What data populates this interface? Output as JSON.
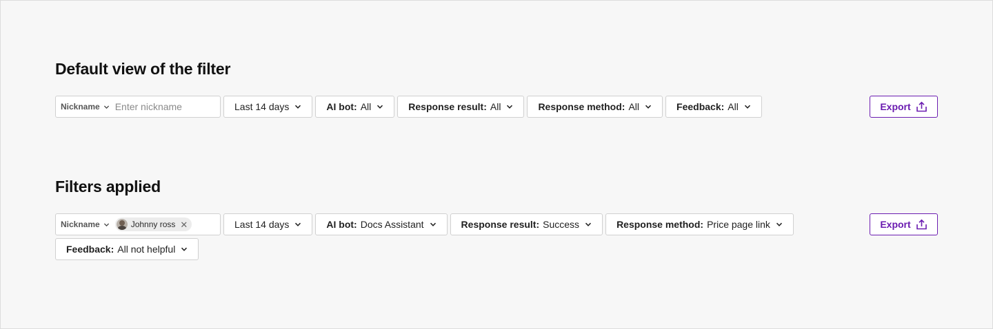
{
  "default_section": {
    "title": "Default view of the filter",
    "nickname": {
      "select_label": "Nickname",
      "placeholder": "Enter nickname"
    },
    "date_range": "Last 14 days",
    "ai_bot": {
      "label": "AI bot:",
      "value": "All"
    },
    "response_result": {
      "label": "Response result:",
      "value": "All"
    },
    "response_method": {
      "label": "Response method:",
      "value": "All"
    },
    "feedback": {
      "label": "Feedback:",
      "value": "All"
    },
    "export_label": "Export"
  },
  "applied_section": {
    "title": "Filters applied",
    "nickname": {
      "select_label": "Nickname",
      "tag": "Johnny ross"
    },
    "date_range": "Last 14 days",
    "ai_bot": {
      "label": "AI bot:",
      "value": "Docs Assistant"
    },
    "response_result": {
      "label": "Response result:",
      "value": "Success"
    },
    "response_method": {
      "label": "Response method:",
      "value": "Price page link"
    },
    "feedback": {
      "label": "Feedback:",
      "value": "All not helpful"
    },
    "export_label": "Export"
  },
  "icons": {
    "dropdown": "chevron-down-icon",
    "remove": "close-icon",
    "export": "upload-icon"
  },
  "colors": {
    "accent": "#6a1bb0",
    "background": "#f7f7f7",
    "border": "#d0d0d0"
  }
}
